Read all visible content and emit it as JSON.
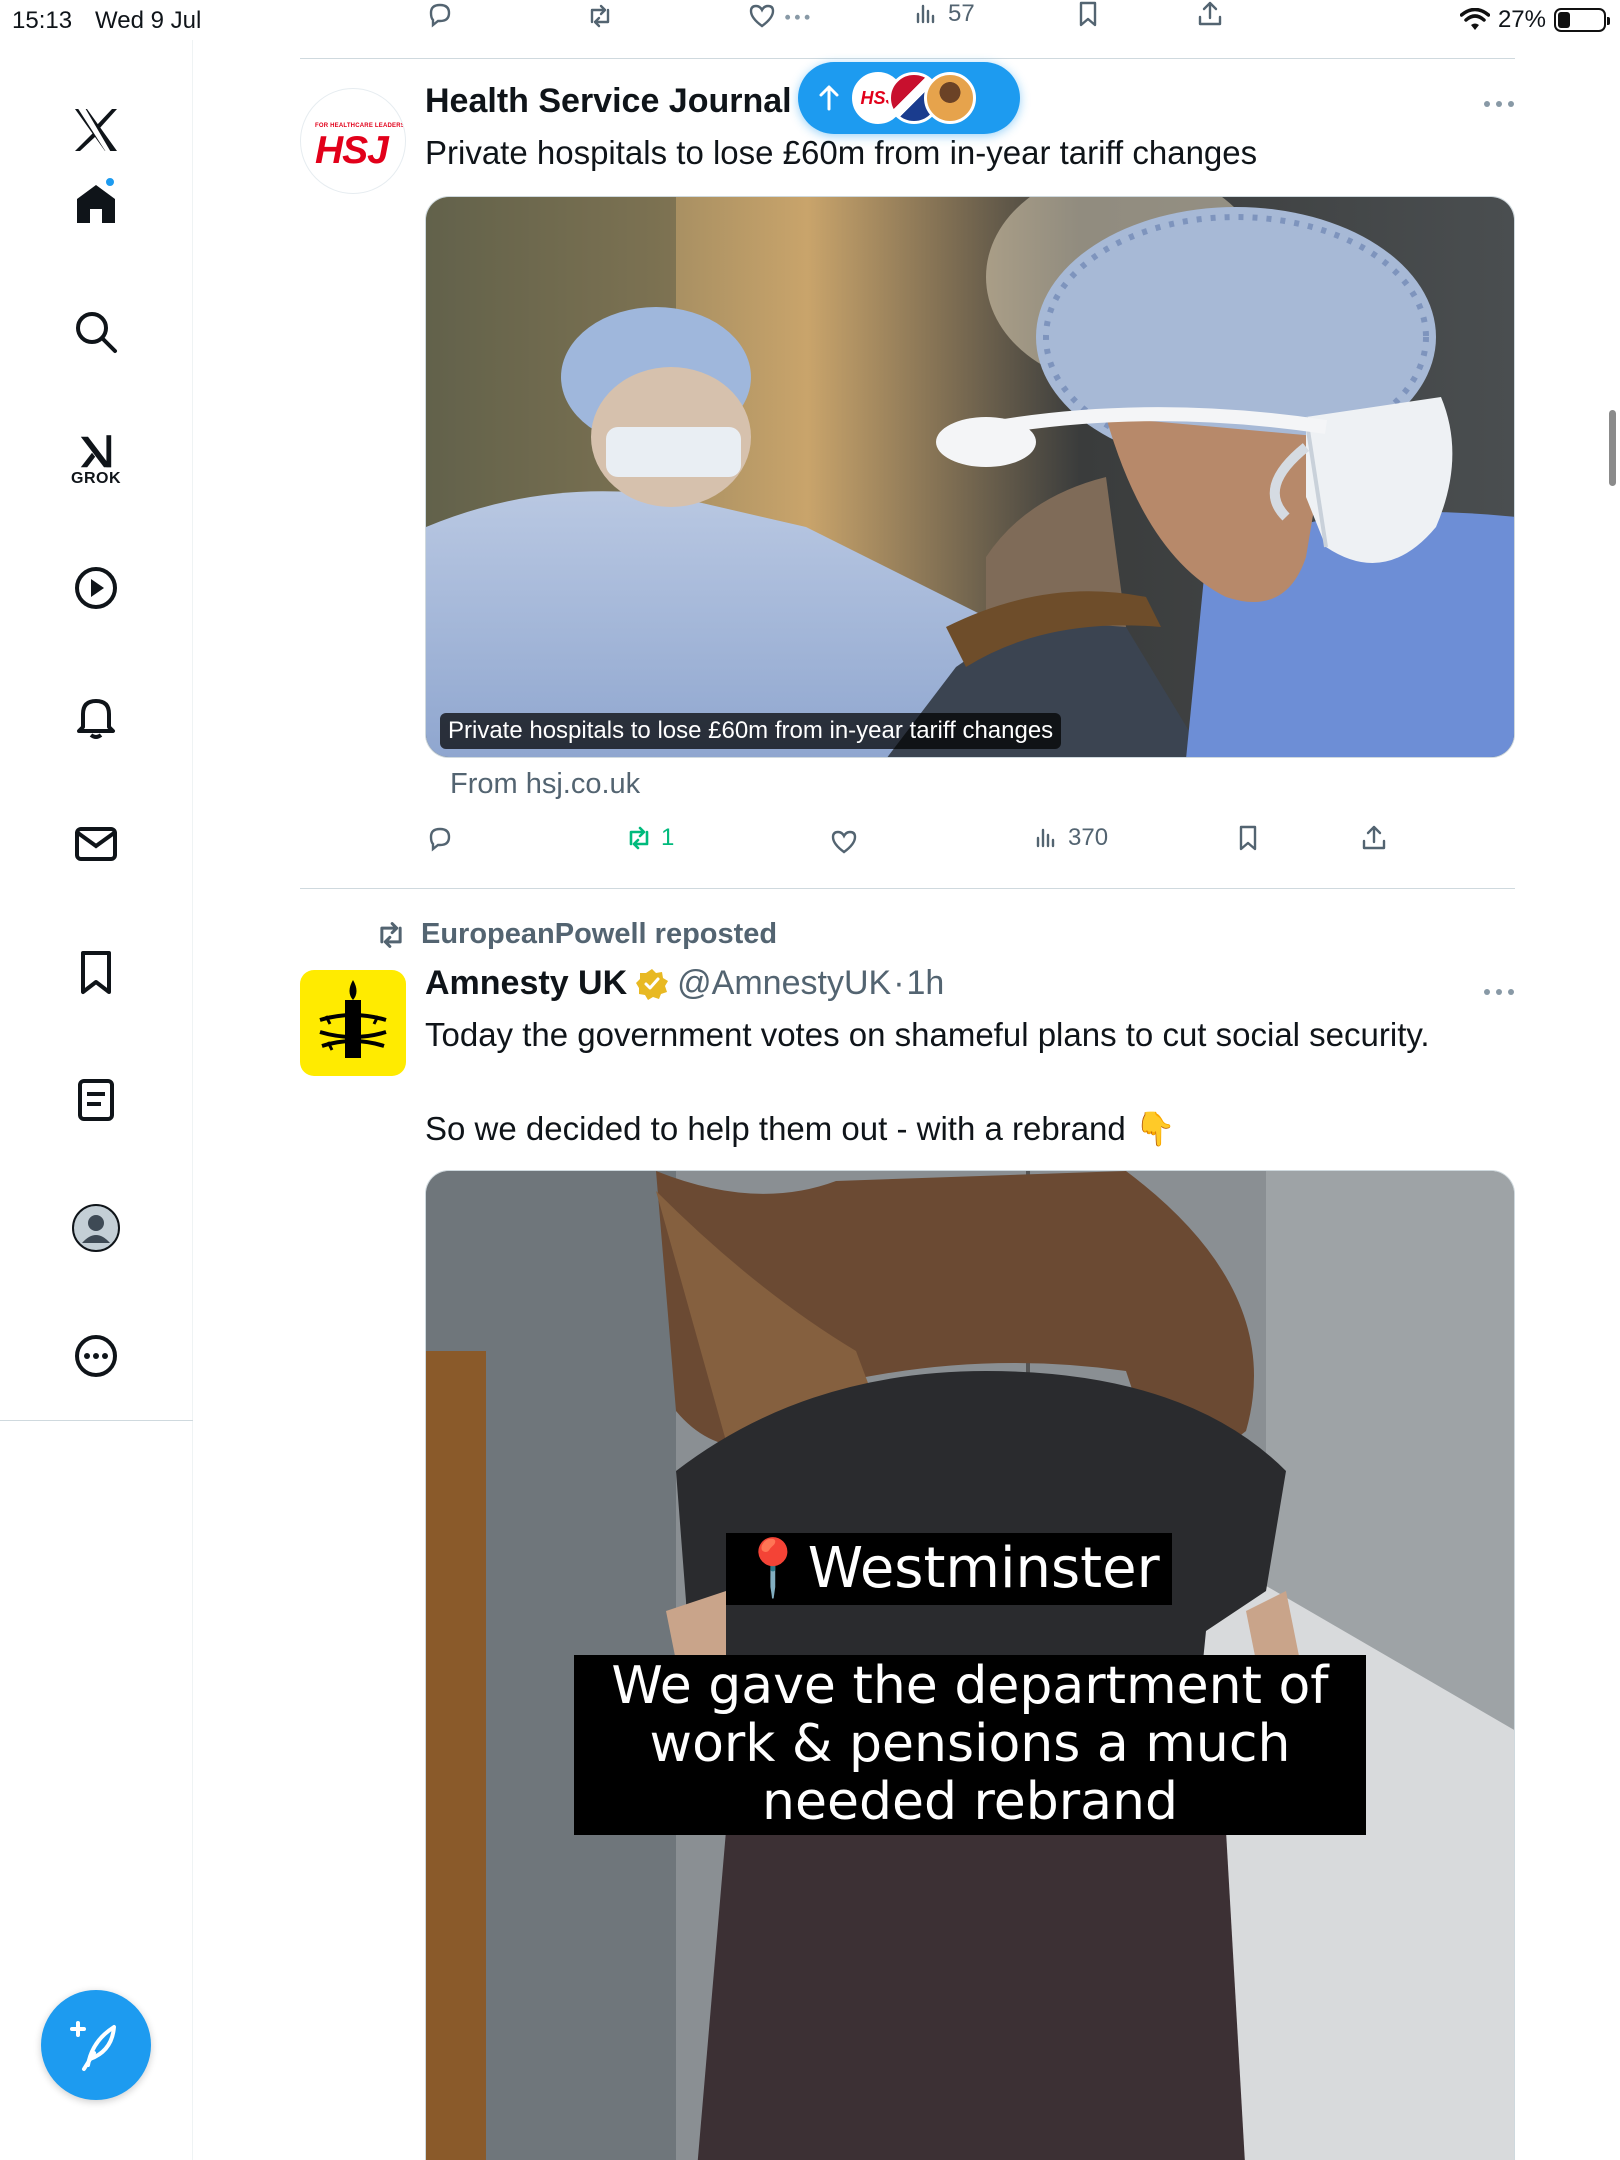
{
  "status_bar": {
    "time": "15:13",
    "date": "Wed 9 Jul",
    "battery": "27%",
    "battery_level": 0.27
  },
  "sidebar": {
    "items": [
      {
        "name": "logo",
        "icon": "x-logo-icon"
      },
      {
        "name": "home",
        "icon": "home-icon",
        "active": true,
        "badge": true
      },
      {
        "name": "explore",
        "icon": "search-icon"
      },
      {
        "name": "grok",
        "icon": "grok-icon",
        "label": "GROK"
      },
      {
        "name": "videos",
        "icon": "play-icon"
      },
      {
        "name": "notifications",
        "icon": "bell-icon"
      },
      {
        "name": "messages",
        "icon": "mail-icon"
      },
      {
        "name": "bookmarks",
        "icon": "bookmark-icon"
      },
      {
        "name": "lists",
        "icon": "list-icon"
      },
      {
        "name": "profile",
        "icon": "profile-icon"
      },
      {
        "name": "more",
        "icon": "more-circle-icon"
      }
    ],
    "compose_icon": "compose-plus-icon"
  },
  "top_actions": {
    "views": "57"
  },
  "new_posts_pill": {
    "icon": "arrow-up-icon",
    "avatar_1_text": "HSJ"
  },
  "tweet1": {
    "name": "Health Service Journal",
    "avatar_text": "HSJ",
    "avatar_subtext": "FOR HEALTHCARE LEADERS",
    "text": "Private hospitals to lose £60m from in-year tariff changes",
    "media_caption": "Private hospitals to lose £60m from in-year tariff changes",
    "link_source": "From hsj.co.uk",
    "reposts": "1",
    "views": "370"
  },
  "tweet2": {
    "repost_by": "EuropeanPowell reposted",
    "name": "Amnesty UK",
    "handle": "@AmnestyUK",
    "separator": "·",
    "time": "1h",
    "text_line1": "Today the government votes on shameful plans to cut social security.",
    "text_line2": "So we decided to help them out - with a rebrand 👇",
    "video_caption_location": "📍Westminster",
    "video_caption_line1": "We gave the department of",
    "video_caption_line2": "work & pensions a much",
    "video_caption_line3": "needed rebrand"
  }
}
